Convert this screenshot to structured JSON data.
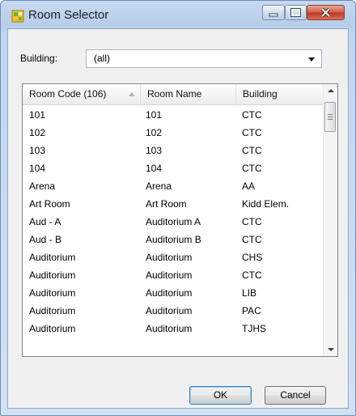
{
  "window": {
    "title": "Room Selector"
  },
  "building": {
    "label": "Building:",
    "value": "(all)"
  },
  "table": {
    "columns": [
      "Room Code (106)",
      "Room Name",
      "Building"
    ],
    "rows": [
      [
        "101",
        "101",
        "CTC"
      ],
      [
        "102",
        "102",
        "CTC"
      ],
      [
        "103",
        "103",
        "CTC"
      ],
      [
        "104",
        "104",
        "CTC"
      ],
      [
        "Arena",
        "Arena",
        "AA"
      ],
      [
        "Art Room",
        "Art Room",
        "Kidd Elem."
      ],
      [
        "Aud - A",
        "Auditorium A",
        "CTC"
      ],
      [
        "Aud - B",
        "Auditorium B",
        "CTC"
      ],
      [
        "Auditorium",
        "Auditorium",
        "CHS"
      ],
      [
        "Auditorium",
        "Auditorium",
        "CTC"
      ],
      [
        "Auditorium",
        "Auditorium",
        "LIB"
      ],
      [
        "Auditorium",
        "Auditorium",
        "PAC"
      ],
      [
        "Auditorium",
        "Auditorium",
        "TJHS"
      ]
    ]
  },
  "buttons": {
    "ok": "OK",
    "cancel": "Cancel"
  },
  "icons": {
    "app": "room-selector-icon",
    "minimize": "minimize-icon",
    "maximize": "maximize-icon",
    "close": "close-icon"
  },
  "colors": {
    "close_button": "#c9483a",
    "title_bar": "#c6d9f1"
  }
}
